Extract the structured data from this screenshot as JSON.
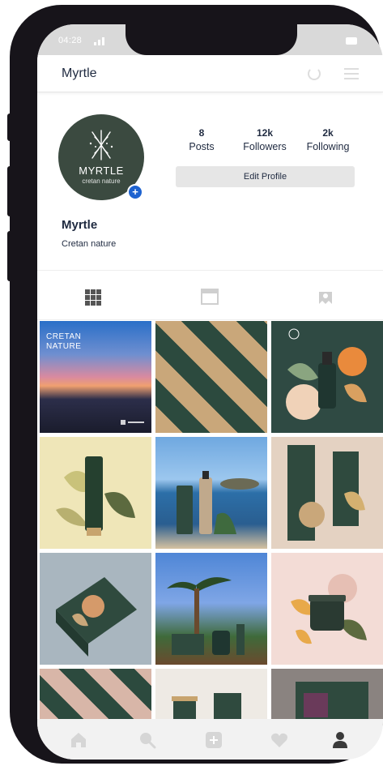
{
  "status_bar": {
    "time": "04:28"
  },
  "header": {
    "title": "Myrtle"
  },
  "profile": {
    "avatar_name": "MYRTLE",
    "avatar_subtitle": "cretan nature",
    "add_symbol": "+",
    "name": "Myrtle",
    "bio": "Cretan nature",
    "stats": [
      {
        "value": "8",
        "label": "Posts"
      },
      {
        "value": "12k",
        "label": "Followers"
      },
      {
        "value": "2k",
        "label": "Following"
      }
    ],
    "edit_button": "Edit Profile"
  },
  "tabs": [
    {
      "icon": "grid-icon",
      "active": true
    },
    {
      "icon": "feed-icon",
      "active": false
    },
    {
      "icon": "tagged-icon",
      "active": false
    }
  ],
  "posts": [
    {
      "label": "CRETAN\nNATURE"
    }
  ],
  "bottom_nav": [
    {
      "icon": "home-icon"
    },
    {
      "icon": "search-icon"
    },
    {
      "icon": "add-post-icon"
    },
    {
      "icon": "heart-icon"
    },
    {
      "icon": "profile-icon",
      "active": true
    }
  ],
  "colors": {
    "brand_green": "#3b4a40",
    "accent_blue": "#1e63d0",
    "text_dark": "#1f2a40",
    "frame": "#17141a"
  }
}
